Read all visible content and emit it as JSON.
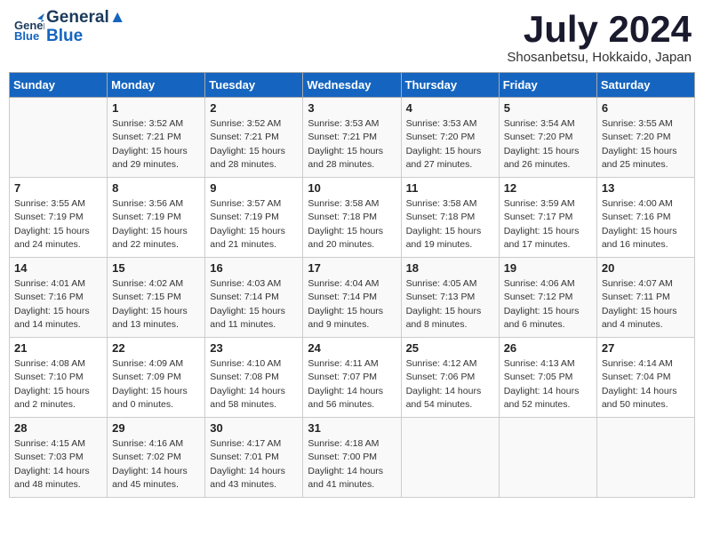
{
  "header": {
    "logo_general": "General",
    "logo_blue": "Blue",
    "month": "July 2024",
    "location": "Shosanbetsu, Hokkaido, Japan"
  },
  "days_of_week": [
    "Sunday",
    "Monday",
    "Tuesday",
    "Wednesday",
    "Thursday",
    "Friday",
    "Saturday"
  ],
  "weeks": [
    [
      {
        "day": "",
        "content": ""
      },
      {
        "day": "1",
        "content": "Sunrise: 3:52 AM\nSunset: 7:21 PM\nDaylight: 15 hours\nand 29 minutes."
      },
      {
        "day": "2",
        "content": "Sunrise: 3:52 AM\nSunset: 7:21 PM\nDaylight: 15 hours\nand 28 minutes."
      },
      {
        "day": "3",
        "content": "Sunrise: 3:53 AM\nSunset: 7:21 PM\nDaylight: 15 hours\nand 28 minutes."
      },
      {
        "day": "4",
        "content": "Sunrise: 3:53 AM\nSunset: 7:20 PM\nDaylight: 15 hours\nand 27 minutes."
      },
      {
        "day": "5",
        "content": "Sunrise: 3:54 AM\nSunset: 7:20 PM\nDaylight: 15 hours\nand 26 minutes."
      },
      {
        "day": "6",
        "content": "Sunrise: 3:55 AM\nSunset: 7:20 PM\nDaylight: 15 hours\nand 25 minutes."
      }
    ],
    [
      {
        "day": "7",
        "content": "Sunrise: 3:55 AM\nSunset: 7:19 PM\nDaylight: 15 hours\nand 24 minutes."
      },
      {
        "day": "8",
        "content": "Sunrise: 3:56 AM\nSunset: 7:19 PM\nDaylight: 15 hours\nand 22 minutes."
      },
      {
        "day": "9",
        "content": "Sunrise: 3:57 AM\nSunset: 7:19 PM\nDaylight: 15 hours\nand 21 minutes."
      },
      {
        "day": "10",
        "content": "Sunrise: 3:58 AM\nSunset: 7:18 PM\nDaylight: 15 hours\nand 20 minutes."
      },
      {
        "day": "11",
        "content": "Sunrise: 3:58 AM\nSunset: 7:18 PM\nDaylight: 15 hours\nand 19 minutes."
      },
      {
        "day": "12",
        "content": "Sunrise: 3:59 AM\nSunset: 7:17 PM\nDaylight: 15 hours\nand 17 minutes."
      },
      {
        "day": "13",
        "content": "Sunrise: 4:00 AM\nSunset: 7:16 PM\nDaylight: 15 hours\nand 16 minutes."
      }
    ],
    [
      {
        "day": "14",
        "content": "Sunrise: 4:01 AM\nSunset: 7:16 PM\nDaylight: 15 hours\nand 14 minutes."
      },
      {
        "day": "15",
        "content": "Sunrise: 4:02 AM\nSunset: 7:15 PM\nDaylight: 15 hours\nand 13 minutes."
      },
      {
        "day": "16",
        "content": "Sunrise: 4:03 AM\nSunset: 7:14 PM\nDaylight: 15 hours\nand 11 minutes."
      },
      {
        "day": "17",
        "content": "Sunrise: 4:04 AM\nSunset: 7:14 PM\nDaylight: 15 hours\nand 9 minutes."
      },
      {
        "day": "18",
        "content": "Sunrise: 4:05 AM\nSunset: 7:13 PM\nDaylight: 15 hours\nand 8 minutes."
      },
      {
        "day": "19",
        "content": "Sunrise: 4:06 AM\nSunset: 7:12 PM\nDaylight: 15 hours\nand 6 minutes."
      },
      {
        "day": "20",
        "content": "Sunrise: 4:07 AM\nSunset: 7:11 PM\nDaylight: 15 hours\nand 4 minutes."
      }
    ],
    [
      {
        "day": "21",
        "content": "Sunrise: 4:08 AM\nSunset: 7:10 PM\nDaylight: 15 hours\nand 2 minutes."
      },
      {
        "day": "22",
        "content": "Sunrise: 4:09 AM\nSunset: 7:09 PM\nDaylight: 15 hours\nand 0 minutes."
      },
      {
        "day": "23",
        "content": "Sunrise: 4:10 AM\nSunset: 7:08 PM\nDaylight: 14 hours\nand 58 minutes."
      },
      {
        "day": "24",
        "content": "Sunrise: 4:11 AM\nSunset: 7:07 PM\nDaylight: 14 hours\nand 56 minutes."
      },
      {
        "day": "25",
        "content": "Sunrise: 4:12 AM\nSunset: 7:06 PM\nDaylight: 14 hours\nand 54 minutes."
      },
      {
        "day": "26",
        "content": "Sunrise: 4:13 AM\nSunset: 7:05 PM\nDaylight: 14 hours\nand 52 minutes."
      },
      {
        "day": "27",
        "content": "Sunrise: 4:14 AM\nSunset: 7:04 PM\nDaylight: 14 hours\nand 50 minutes."
      }
    ],
    [
      {
        "day": "28",
        "content": "Sunrise: 4:15 AM\nSunset: 7:03 PM\nDaylight: 14 hours\nand 48 minutes."
      },
      {
        "day": "29",
        "content": "Sunrise: 4:16 AM\nSunset: 7:02 PM\nDaylight: 14 hours\nand 45 minutes."
      },
      {
        "day": "30",
        "content": "Sunrise: 4:17 AM\nSunset: 7:01 PM\nDaylight: 14 hours\nand 43 minutes."
      },
      {
        "day": "31",
        "content": "Sunrise: 4:18 AM\nSunset: 7:00 PM\nDaylight: 14 hours\nand 41 minutes."
      },
      {
        "day": "",
        "content": ""
      },
      {
        "day": "",
        "content": ""
      },
      {
        "day": "",
        "content": ""
      }
    ]
  ]
}
